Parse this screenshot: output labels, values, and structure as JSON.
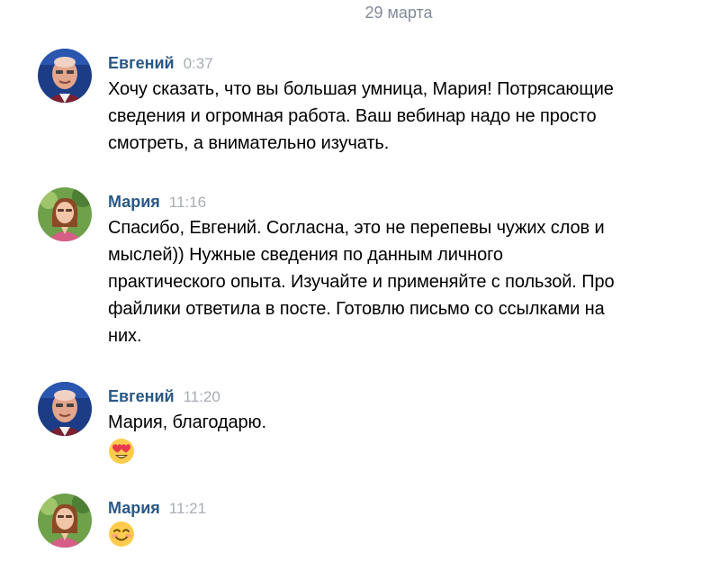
{
  "date_separator": "29 марта",
  "messages": [
    {
      "author": "Евгений",
      "time": "0:37",
      "lines": [
        "Хочу сказать, что вы большая умница, Мария! Потрясающие",
        "сведения и огромная работа. Ваш вебинар надо не просто",
        "смотреть, а внимательно изучать."
      ]
    },
    {
      "author": "Мария",
      "time": "11:16",
      "lines": [
        "Спасибо, Евгений. Согласна, это не перепевы чужих слов и",
        "мыслей)) Нужные сведения по данным личного",
        "практического опыта. Изучайте и применяйте с пользой. Про",
        "файлики ответила в посте. Готовлю письмо со ссылками на",
        "них."
      ]
    },
    {
      "author": "Евгений",
      "time": "11:20",
      "lines": [
        "Мария, благодарю."
      ],
      "emoji": "heart-eyes-emoji"
    },
    {
      "author": "Мария",
      "time": "11:21",
      "lines": [],
      "emoji": "smiling-face-emoji"
    }
  ],
  "colors": {
    "author": "#2a5885",
    "time": "#a8adb5",
    "date": "#828a99",
    "text": "#000000"
  }
}
